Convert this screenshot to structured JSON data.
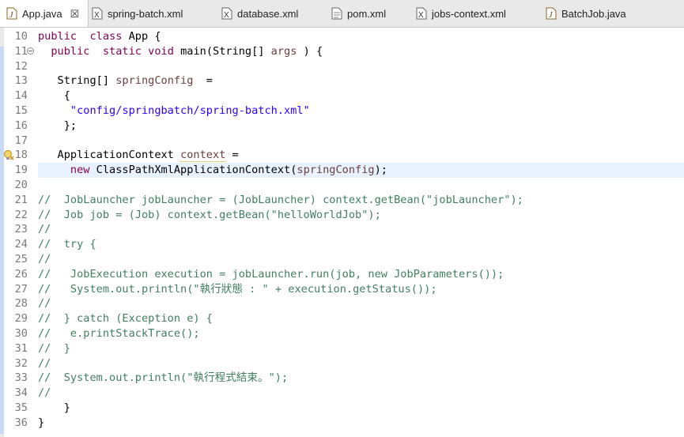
{
  "tabs": [
    {
      "label": "App.java",
      "icon": "java-file-icon",
      "active": true,
      "close": "☒"
    },
    {
      "label": "spring-batch.xml",
      "icon": "xml-file-icon"
    },
    {
      "label": "database.xml",
      "icon": "xml-file-icon"
    },
    {
      "label": "pom.xml",
      "icon": "document-icon"
    },
    {
      "label": "jobs-context.xml",
      "icon": "xml-file-icon"
    },
    {
      "label": "BatchJob.java",
      "icon": "java-file-icon"
    }
  ],
  "lines": [
    {
      "num": "10",
      "segs": [
        [
          "kw",
          "public"
        ],
        [
          "",
          "  "
        ],
        [
          "kw",
          "class"
        ],
        [
          "",
          " App {"
        ]
      ]
    },
    {
      "num": "11",
      "fold": true,
      "segs": [
        [
          "",
          "  "
        ],
        [
          "kw",
          "public"
        ],
        [
          "",
          "  "
        ],
        [
          "kw",
          "static"
        ],
        [
          "",
          " "
        ],
        [
          "kw",
          "void"
        ],
        [
          "",
          " main(String[] "
        ],
        [
          "var",
          "args"
        ],
        [
          "",
          " ) {"
        ]
      ]
    },
    {
      "num": "12",
      "segs": []
    },
    {
      "num": "13",
      "segs": [
        [
          "",
          "   String[] "
        ],
        [
          "var",
          "springConfig"
        ],
        [
          "",
          "  ="
        ]
      ]
    },
    {
      "num": "14",
      "segs": [
        [
          "",
          "    {"
        ]
      ]
    },
    {
      "num": "15",
      "segs": [
        [
          "",
          "     "
        ],
        [
          "str",
          "\"config/springbatch/spring-batch.xml\""
        ]
      ]
    },
    {
      "num": "16",
      "segs": [
        [
          "",
          "    };"
        ]
      ]
    },
    {
      "num": "17",
      "segs": []
    },
    {
      "num": "18",
      "marker": true,
      "segs": [
        [
          "",
          "   ApplicationContext "
        ],
        [
          "var warn",
          "context"
        ],
        [
          "",
          " ="
        ]
      ]
    },
    {
      "num": "19",
      "highlight": true,
      "segs": [
        [
          "",
          "     "
        ],
        [
          "kw",
          "new"
        ],
        [
          "",
          " ClassPathXmlApplicationContext("
        ],
        [
          "var",
          "springConfig"
        ],
        [
          "",
          ");"
        ]
      ]
    },
    {
      "num": "20",
      "segs": []
    },
    {
      "num": "21",
      "segs": [
        [
          "cm",
          "//  JobLauncher jobLauncher = (JobLauncher) context.getBean(\"jobLauncher\");"
        ]
      ]
    },
    {
      "num": "22",
      "segs": [
        [
          "cm",
          "//  Job job = (Job) context.getBean(\"helloWorldJob\");"
        ]
      ]
    },
    {
      "num": "23",
      "segs": [
        [
          "cm",
          "//"
        ]
      ]
    },
    {
      "num": "24",
      "segs": [
        [
          "cm",
          "//  try {"
        ]
      ]
    },
    {
      "num": "25",
      "segs": [
        [
          "cm",
          "//"
        ]
      ]
    },
    {
      "num": "26",
      "segs": [
        [
          "cm",
          "//   JobExecution execution = jobLauncher.run(job, new JobParameters());"
        ]
      ]
    },
    {
      "num": "27",
      "segs": [
        [
          "cm",
          "//   System.out.println(\"執行狀態 : \" + execution.getStatus());"
        ]
      ]
    },
    {
      "num": "28",
      "segs": [
        [
          "cm",
          "//"
        ]
      ]
    },
    {
      "num": "29",
      "segs": [
        [
          "cm",
          "//  } catch (Exception e) {"
        ]
      ]
    },
    {
      "num": "30",
      "segs": [
        [
          "cm",
          "//   e.printStackTrace();"
        ]
      ]
    },
    {
      "num": "31",
      "segs": [
        [
          "cm",
          "//  }"
        ]
      ]
    },
    {
      "num": "32",
      "segs": [
        [
          "cm",
          "//"
        ]
      ]
    },
    {
      "num": "33",
      "segs": [
        [
          "cm",
          "//  System.out.println(\"執行程式結束。\");"
        ]
      ]
    },
    {
      "num": "34",
      "segs": [
        [
          "cm",
          "//"
        ]
      ]
    },
    {
      "num": "35",
      "segs": [
        [
          "",
          "    }"
        ]
      ]
    },
    {
      "num": "36",
      "segs": [
        [
          "",
          "}"
        ]
      ]
    }
  ],
  "colors": {
    "keyword": "#7f0055",
    "string": "#2a00ff",
    "comment": "#3f7f5f",
    "variable": "#6a3e3e",
    "current_line": "#e8f2fe"
  }
}
